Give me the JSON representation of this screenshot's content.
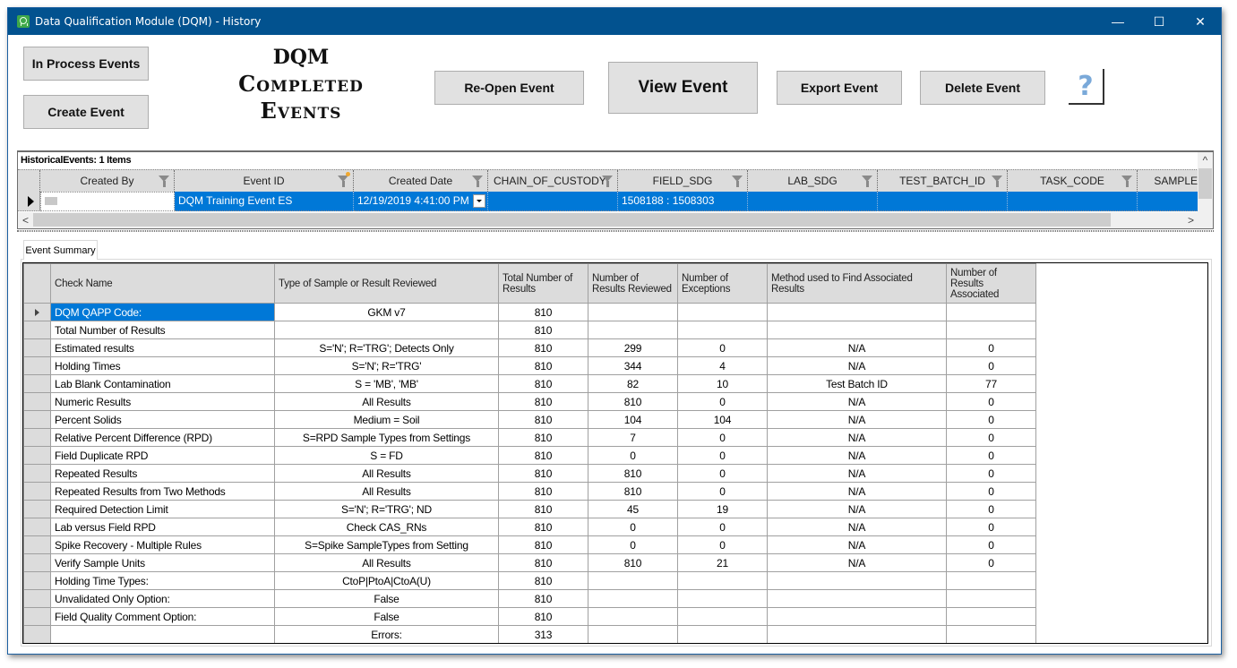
{
  "window": {
    "title": "Data Qualification Module (DQM) -  History",
    "controls": {
      "minimize": "—",
      "maximize": "☐",
      "close": "✕"
    }
  },
  "toolbar": {
    "in_process_label": "In Process Events",
    "create_label": "Create Event",
    "reopen_label": "Re-Open  Event",
    "view_label": "View  Event",
    "export_label": "Export Event",
    "delete_label": "Delete Event",
    "help_label": "?"
  },
  "headline": {
    "line1": "DQM",
    "line2": "Completed",
    "line3": "Events"
  },
  "events_grid": {
    "caption": "HistoricalEvents: 1 Items",
    "columns": [
      {
        "label": "Created By",
        "filter": true,
        "filter_active": false
      },
      {
        "label": "Event ID",
        "filter": true,
        "filter_active": true
      },
      {
        "label": "Created Date",
        "filter": true,
        "filter_active": false
      },
      {
        "label": "CHAIN_OF_CUSTODY",
        "filter": true,
        "filter_active": false
      },
      {
        "label": "FIELD_SDG",
        "filter": true,
        "filter_active": false
      },
      {
        "label": "LAB_SDG",
        "filter": true,
        "filter_active": false
      },
      {
        "label": "TEST_BATCH_ID",
        "filter": true,
        "filter_active": false
      },
      {
        "label": "TASK_CODE",
        "filter": true,
        "filter_active": false
      },
      {
        "label": "SAMPLE",
        "filter": false,
        "filter_active": false
      }
    ],
    "rows": [
      {
        "created_by": "",
        "event_id": "DQM Training Event ES",
        "created_date": "12/19/2019 4:41:00 PM",
        "chain_of_custody": "",
        "field_sdg": "1508188 : 1508303",
        "lab_sdg": "",
        "test_batch_id": "",
        "task_code": "",
        "sample": ""
      }
    ],
    "scroll_left": "<",
    "scroll_right": ">",
    "scroll_up": "^"
  },
  "tabs": [
    {
      "label": "Event Summary",
      "active": true
    }
  ],
  "summary": {
    "columns": [
      "Check Name",
      "Type of Sample or Result Reviewed",
      "Total Number of Results",
      "Number of Results Reviewed",
      "Number of Exceptions",
      "Method used to Find Associated Results",
      "Number of Results Associated"
    ],
    "rows": [
      {
        "check": "DQM QAPP Code:",
        "type": "GKM v7",
        "total": "810",
        "reviewed": "",
        "exceptions": "",
        "method": "",
        "associated": "",
        "selected": true
      },
      {
        "check": "Total Number of Results",
        "type": "",
        "total": "810",
        "reviewed": "",
        "exceptions": "",
        "method": "",
        "associated": ""
      },
      {
        "check": "Estimated results",
        "type": "S='N'; R='TRG'; Detects Only",
        "total": "810",
        "reviewed": "299",
        "exceptions": "0",
        "method": "N/A",
        "associated": "0"
      },
      {
        "check": "Holding Times",
        "type": "S='N'; R='TRG'",
        "total": "810",
        "reviewed": "344",
        "exceptions": "4",
        "method": "N/A",
        "associated": "0"
      },
      {
        "check": "Lab Blank Contamination",
        "type": "S = 'MB', 'MB'",
        "total": "810",
        "reviewed": "82",
        "exceptions": "10",
        "method": "Test Batch ID",
        "associated": "77"
      },
      {
        "check": "Numeric Results",
        "type": "All Results",
        "total": "810",
        "reviewed": "810",
        "exceptions": "0",
        "method": "N/A",
        "associated": "0"
      },
      {
        "check": "Percent Solids",
        "type": "Medium = Soil",
        "total": "810",
        "reviewed": "104",
        "exceptions": "104",
        "method": "N/A",
        "associated": "0"
      },
      {
        "check": "Relative Percent Difference (RPD)",
        "type": "S=RPD Sample Types from Settings",
        "total": "810",
        "reviewed": "7",
        "exceptions": "0",
        "method": "N/A",
        "associated": "0"
      },
      {
        "check": "Field Duplicate RPD",
        "type": "S = FD",
        "total": "810",
        "reviewed": "0",
        "exceptions": "0",
        "method": "N/A",
        "associated": "0"
      },
      {
        "check": "Repeated Results",
        "type": "All Results",
        "total": "810",
        "reviewed": "810",
        "exceptions": "0",
        "method": "N/A",
        "associated": "0"
      },
      {
        "check": "Repeated Results from Two Methods",
        "type": "All Results",
        "total": "810",
        "reviewed": "810",
        "exceptions": "0",
        "method": "N/A",
        "associated": "0"
      },
      {
        "check": "Required Detection Limit",
        "type": "S='N'; R='TRG'; ND",
        "total": "810",
        "reviewed": "45",
        "exceptions": "19",
        "method": "N/A",
        "associated": "0"
      },
      {
        "check": "Lab versus Field RPD",
        "type": "Check CAS_RNs",
        "total": "810",
        "reviewed": "0",
        "exceptions": "0",
        "method": "N/A",
        "associated": "0"
      },
      {
        "check": "Spike Recovery - Multiple Rules",
        "type": "S=Spike SampleTypes from Setting",
        "total": "810",
        "reviewed": "0",
        "exceptions": "0",
        "method": "N/A",
        "associated": "0"
      },
      {
        "check": "Verify Sample Units",
        "type": "All Results",
        "total": "810",
        "reviewed": "810",
        "exceptions": "21",
        "method": "N/A",
        "associated": "0"
      },
      {
        "check": "Holding Time Types:",
        "type": "CtoP|PtoA|CtoA(U)",
        "total": "810",
        "reviewed": "",
        "exceptions": "",
        "method": "",
        "associated": ""
      },
      {
        "check": "Unvalidated Only Option:",
        "type": "False",
        "total": "810",
        "reviewed": "",
        "exceptions": "",
        "method": "",
        "associated": ""
      },
      {
        "check": "Field Quality Comment Option:",
        "type": "False",
        "total": "810",
        "reviewed": "",
        "exceptions": "",
        "method": "",
        "associated": ""
      },
      {
        "check": "",
        "type": "Errors:",
        "total": "313",
        "reviewed": "",
        "exceptions": "",
        "method": "",
        "associated": ""
      }
    ]
  },
  "colors": {
    "titlebar": "#02528f",
    "selection": "#0078d7",
    "button_bg": "#e1e1e1",
    "header_bg": "#dcdcdc",
    "help_icon": "#7aa9d9"
  }
}
